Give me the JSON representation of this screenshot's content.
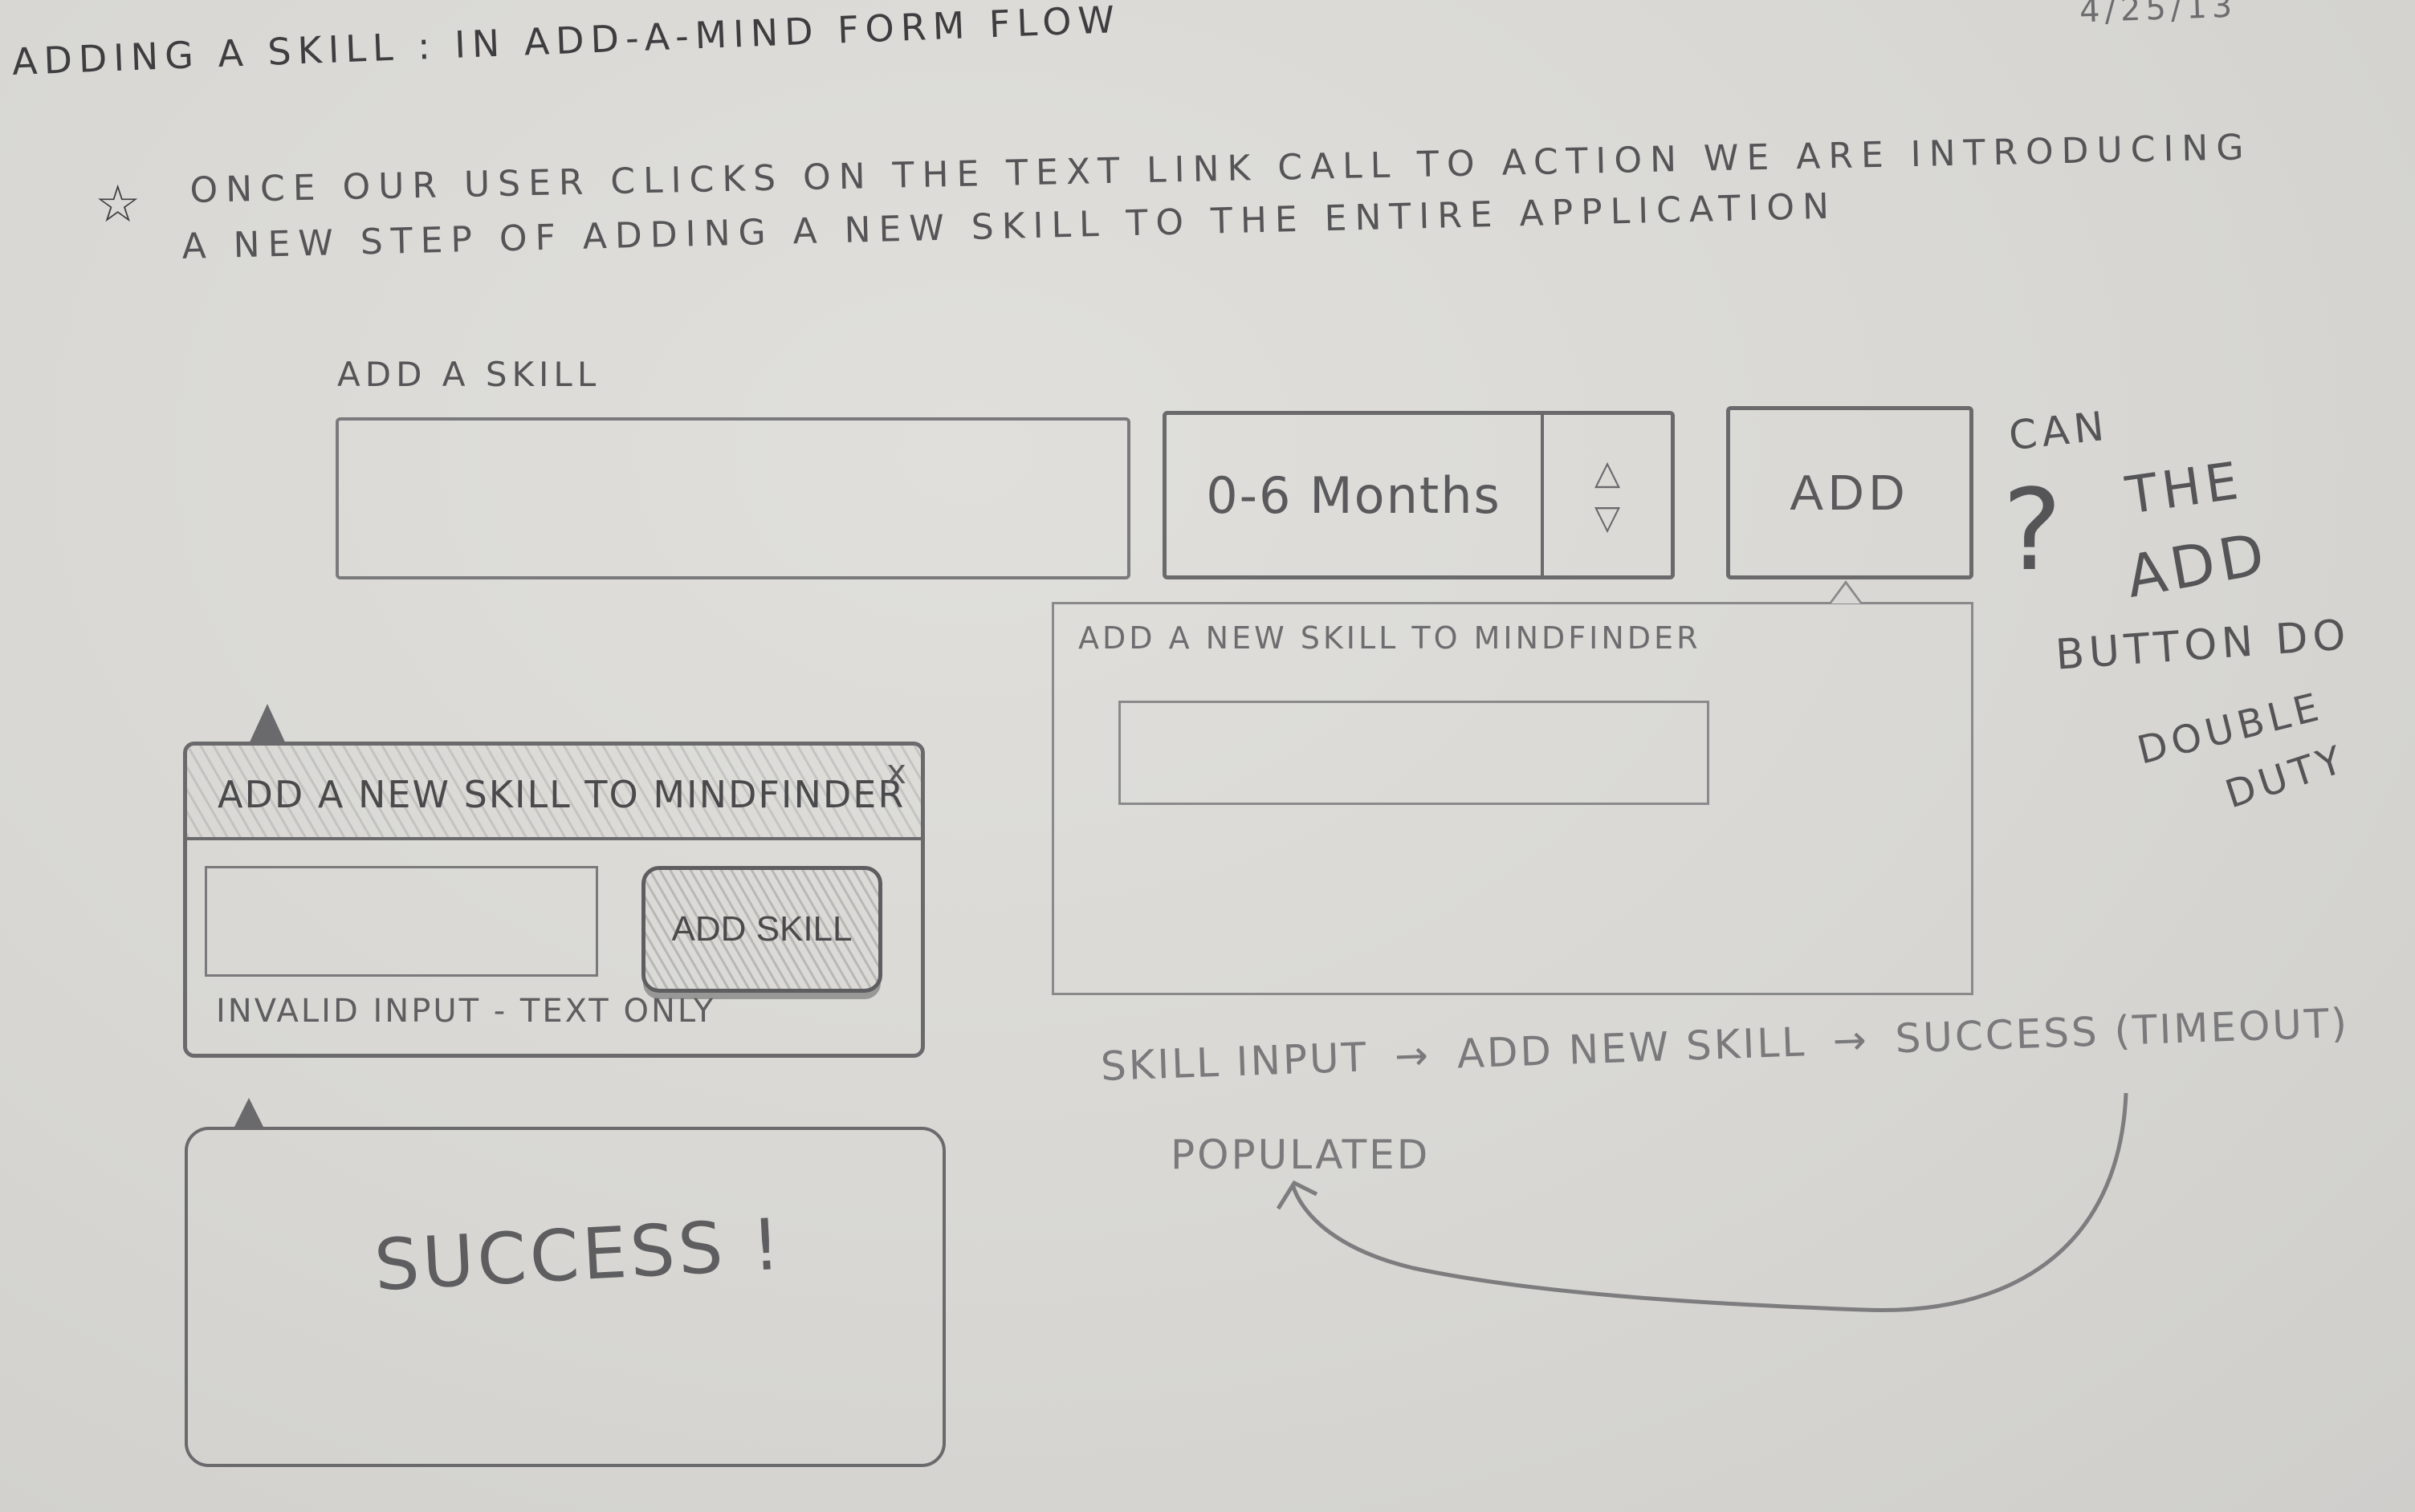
{
  "date": "4/25/13",
  "title": "Adding a skill : in add-a-mind form flow",
  "intro": {
    "icon": "star-icon",
    "line1": "Once our user clicks on the text link call to action we are introducing",
    "line2": "a new step of adding a new skill to the entire application"
  },
  "form": {
    "label": "Add a skill",
    "skill_input_value": "",
    "duration_value": "0-6 Months",
    "stepper_up": "△",
    "stepper_down": "▽",
    "add_button": "ADD"
  },
  "side_note": {
    "question_mark": "?",
    "lines": [
      "Can",
      "the",
      "Add",
      "Button do",
      "double",
      "duty"
    ]
  },
  "popover_large": {
    "title": "Add a new skill to MindFinder",
    "input_value": ""
  },
  "popover_error": {
    "title": "Add a new skill to MindFinder",
    "close": "x",
    "input_value": "",
    "button": "Add Skill",
    "error": "Invalid input - text only"
  },
  "popover_success": {
    "message": "Success !"
  },
  "flow": {
    "steps": [
      "Skill input",
      "Add new skill",
      "Success (timeout)"
    ],
    "arrow": "→",
    "return_label": "populated"
  }
}
